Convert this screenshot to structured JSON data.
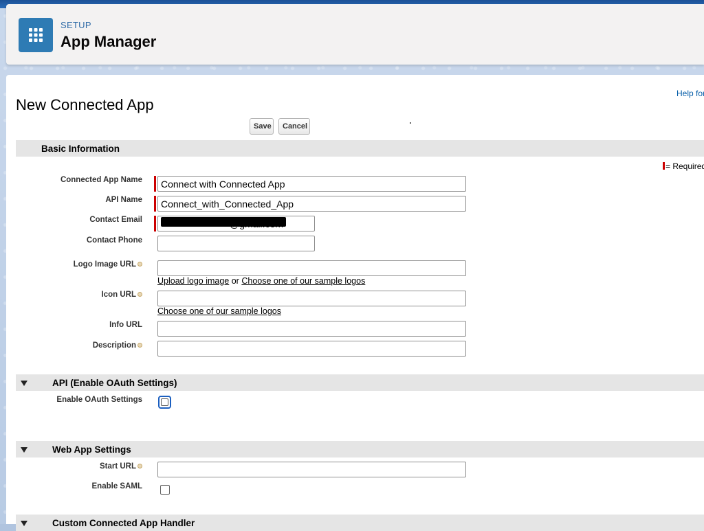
{
  "header": {
    "eyebrow": "SETUP",
    "title": "App Manager",
    "icon": "app-grid-icon"
  },
  "page": {
    "title": "New Connected App",
    "help_link": "Help for"
  },
  "toolbar": {
    "save_label": "Save",
    "cancel_label": "Cancel"
  },
  "required_legend": "= Required",
  "sections": {
    "basic": {
      "title": "Basic Information"
    },
    "api": {
      "title": "API (Enable OAuth Settings)"
    },
    "webapp": {
      "title": "Web App Settings"
    },
    "handler": {
      "title": "Custom Connected App Handler"
    }
  },
  "fields": {
    "connected_app_name": {
      "label": "Connected App Name",
      "value": "Connect with Connected App",
      "required": true
    },
    "api_name": {
      "label": "API Name",
      "value": "Connect_with_Connected_App",
      "required": true
    },
    "contact_email": {
      "label": "Contact Email",
      "value": "@gmail.com",
      "required": true,
      "redacted": true
    },
    "contact_phone": {
      "label": "Contact Phone",
      "value": ""
    },
    "logo_image_url": {
      "label": "Logo Image URL",
      "value": "",
      "has_info": true
    },
    "icon_url": {
      "label": "Icon URL",
      "value": "",
      "has_info": true
    },
    "info_url": {
      "label": "Info URL",
      "value": ""
    },
    "description": {
      "label": "Description",
      "value": "",
      "has_info": true
    },
    "enable_oauth": {
      "label": "Enable OAuth Settings",
      "checked": false
    },
    "start_url": {
      "label": "Start URL",
      "value": "",
      "has_info": true
    },
    "enable_saml": {
      "label": "Enable SAML",
      "checked": false
    }
  },
  "links": {
    "upload_logo": "Upload logo image",
    "or_text": "or",
    "choose_sample_logos": "Choose one of our sample logos",
    "choose_sample_logos_icon": "Choose one of our sample logos"
  },
  "colors": {
    "header_bg": "#f3f2f2",
    "tile_bg": "#2e7bb4",
    "required": "#cc0000",
    "section_bar": "#e5e5e5",
    "link": "#015ba7"
  }
}
